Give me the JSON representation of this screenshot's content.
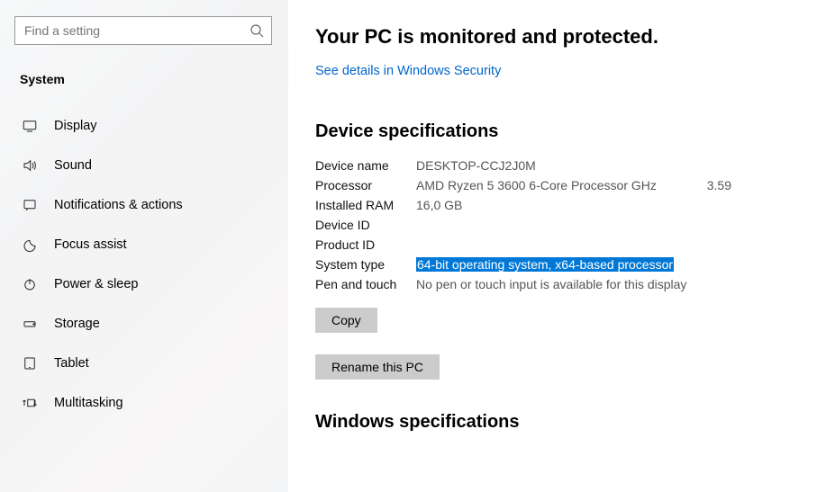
{
  "search": {
    "placeholder": "Find a setting"
  },
  "section": "System",
  "nav": [
    {
      "id": "display",
      "label": "Display"
    },
    {
      "id": "sound",
      "label": "Sound"
    },
    {
      "id": "notifications",
      "label": "Notifications & actions"
    },
    {
      "id": "focus",
      "label": "Focus assist"
    },
    {
      "id": "power",
      "label": "Power & sleep"
    },
    {
      "id": "storage",
      "label": "Storage"
    },
    {
      "id": "tablet",
      "label": "Tablet"
    },
    {
      "id": "multitask",
      "label": "Multitasking"
    }
  ],
  "main": {
    "headline": "Your PC is monitored and protected.",
    "security_link": "See details in Windows Security",
    "device_spec_heading": "Device specifications",
    "specs": {
      "device_name": {
        "label": "Device name",
        "value": "DESKTOP-CCJ2J0M"
      },
      "processor": {
        "label": "Processor",
        "value": "AMD Ryzen 5 3600 6-Core Processor GHz",
        "extra": "3.59"
      },
      "ram": {
        "label": "Installed RAM",
        "value": "16,0 GB"
      },
      "device_id": {
        "label": "Device ID",
        "value": ""
      },
      "product_id": {
        "label": "Product ID",
        "value": ""
      },
      "system_type": {
        "label": "System type",
        "value": "64-bit operating system, x64-based processor"
      },
      "pen_touch": {
        "label": "Pen and touch",
        "value": "No pen or touch input is available for this display"
      }
    },
    "copy_btn": "Copy",
    "rename_btn": "Rename this PC",
    "win_spec_heading": "Windows specifications"
  }
}
